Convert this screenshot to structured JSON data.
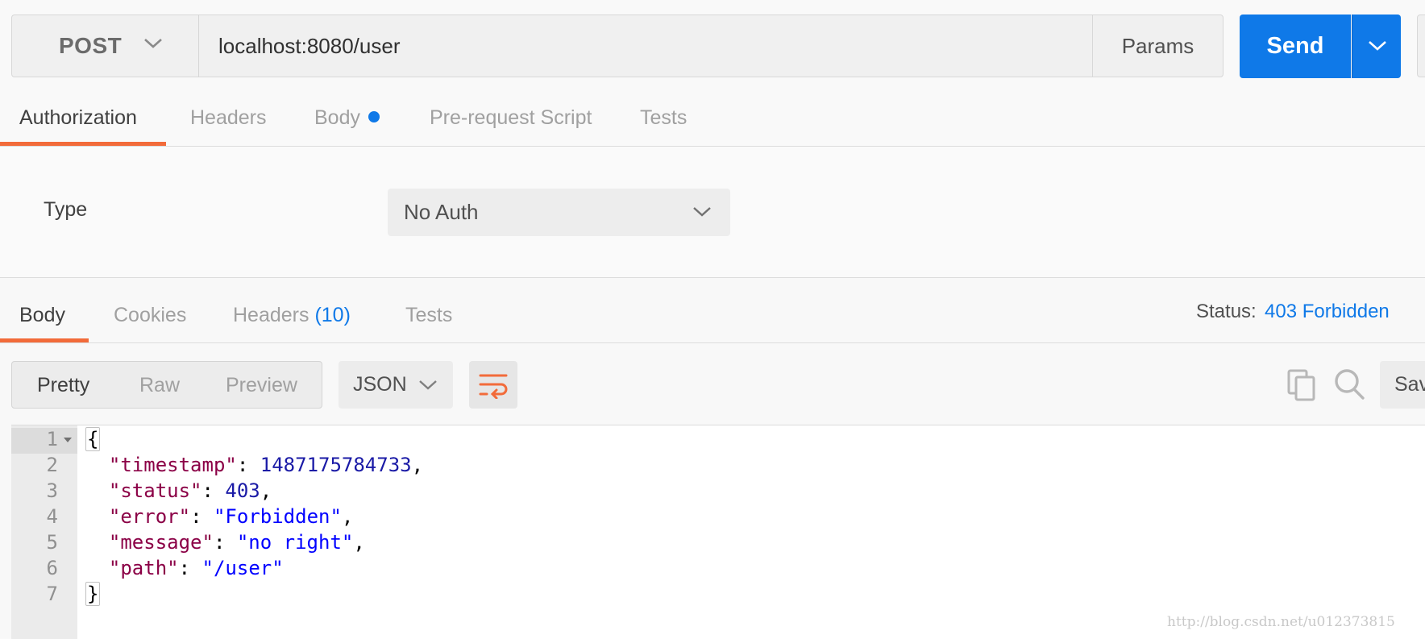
{
  "request": {
    "method": "POST",
    "url": "localhost:8080/user",
    "params_label": "Params",
    "send_label": "Send"
  },
  "request_tabs": [
    {
      "label": "Authorization",
      "active": true
    },
    {
      "label": "Headers",
      "active": false
    },
    {
      "label": "Body",
      "active": false,
      "has_dot": true
    },
    {
      "label": "Pre-request Script",
      "active": false
    },
    {
      "label": "Tests",
      "active": false
    }
  ],
  "auth": {
    "type_label": "Type",
    "type_value": "No Auth"
  },
  "response_tabs": [
    {
      "label": "Body",
      "active": true
    },
    {
      "label": "Cookies",
      "active": false
    },
    {
      "label": "Headers",
      "count": "(10)",
      "active": false
    },
    {
      "label": "Tests",
      "active": false
    }
  ],
  "status": {
    "label": "Status:",
    "value": "403 Forbidden"
  },
  "view_modes": [
    "Pretty",
    "Raw",
    "Preview"
  ],
  "active_view_mode": "Pretty",
  "format": "JSON",
  "save_label": "Sav",
  "icons": {
    "method_dropdown": "chevron-down-icon",
    "send_dropdown": "chevron-down-icon",
    "auth_dropdown": "chevron-down-icon",
    "format_dropdown": "chevron-down-icon",
    "wrap": "wrap-lines-icon",
    "copy": "copy-icon",
    "search": "search-icon",
    "fold": "fold-arrow-icon"
  },
  "colors": {
    "accent_orange": "#f26b3a",
    "send_blue": "#0f79e8",
    "status_blue": "#0f79e8",
    "json_key": "#8b0046",
    "json_number": "#1a1aa6",
    "json_string": "#0000ff"
  },
  "code": {
    "line_numbers": [
      "1",
      "2",
      "3",
      "4",
      "5",
      "6",
      "7"
    ],
    "open_brace": "{",
    "close_brace": "}",
    "entries": [
      {
        "key": "\"timestamp\"",
        "value": "1487175784733",
        "kind": "number",
        "comma": ","
      },
      {
        "key": "\"status\"",
        "value": "403",
        "kind": "number",
        "comma": ","
      },
      {
        "key": "\"error\"",
        "value": "\"Forbidden\"",
        "kind": "string",
        "comma": ","
      },
      {
        "key": "\"message\"",
        "value": "\"no right\"",
        "kind": "string",
        "comma": ","
      },
      {
        "key": "\"path\"",
        "value": "\"/user\"",
        "kind": "string",
        "comma": ""
      }
    ]
  },
  "watermark": "http://blog.csdn.net/u012373815"
}
